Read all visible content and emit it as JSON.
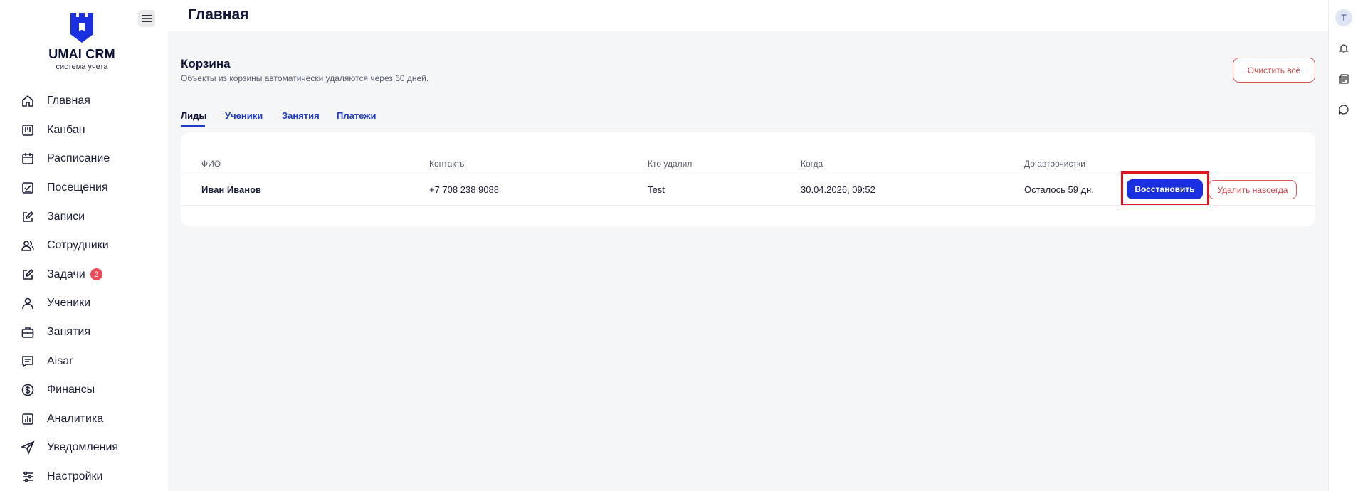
{
  "brand": {
    "title": "UMAI CRM",
    "subtitle": "система учета"
  },
  "sidebar": {
    "items": [
      {
        "label": "Главная",
        "icon": "home-icon"
      },
      {
        "label": "Канбан",
        "icon": "kanban-icon"
      },
      {
        "label": "Расписание",
        "icon": "calendar-icon"
      },
      {
        "label": "Посещения",
        "icon": "attendance-icon"
      },
      {
        "label": "Записи",
        "icon": "edit-icon"
      },
      {
        "label": "Сотрудники",
        "icon": "users-icon"
      },
      {
        "label": "Задачи",
        "icon": "tasks-icon",
        "badge": "2"
      },
      {
        "label": "Ученики",
        "icon": "user-icon"
      },
      {
        "label": "Занятия",
        "icon": "briefcase-icon"
      },
      {
        "label": "Aisar",
        "icon": "chat-list-icon"
      },
      {
        "label": "Финансы",
        "icon": "dollar-icon"
      },
      {
        "label": "Аналитика",
        "icon": "chart-icon"
      },
      {
        "label": "Уведомления",
        "icon": "send-icon"
      },
      {
        "label": "Настройки",
        "icon": "sliders-icon"
      }
    ]
  },
  "header": {
    "title": "Главная"
  },
  "rail": {
    "avatar_initial": "T"
  },
  "trash": {
    "title": "Корзина",
    "subtitle": "Объекты из корзины автоматически удаляются через 60 дней.",
    "clear_label": "Очистить всё",
    "tabs": [
      "Лиды",
      "Ученики",
      "Занятия",
      "Платежи"
    ],
    "columns": [
      "ФИО",
      "Контакты",
      "Кто удалил",
      "Когда",
      "До автоочистки"
    ],
    "rows": [
      {
        "name": "Иван Иванов",
        "contact": "+7 708 238 9088",
        "deleted_by": "Test",
        "when": "30.04.2026, 09:52",
        "remaining": "Осталось 59 дн.",
        "restore_label": "Восстановить",
        "delete_label": "Удалить навсегда"
      }
    ]
  },
  "colors": {
    "accent": "#1a2fe0",
    "danger": "#d85b5b",
    "highlight": "#e0141e",
    "badge": "#ef4b5a"
  }
}
